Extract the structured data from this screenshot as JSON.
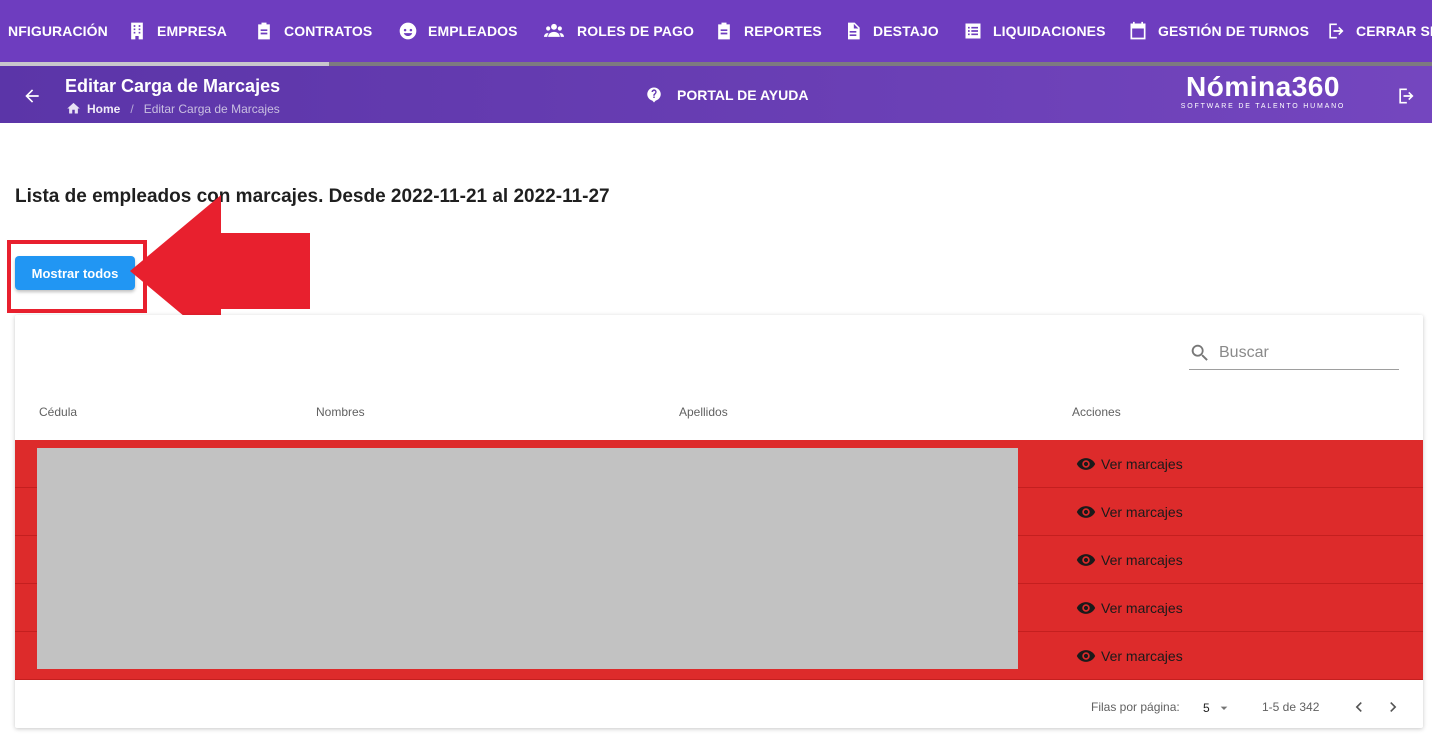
{
  "topnav": {
    "items": [
      {
        "label": "NFIGURACIÓN",
        "icon": "settings-icon"
      },
      {
        "label": "EMPRESA",
        "icon": "building-icon"
      },
      {
        "label": "CONTRATOS",
        "icon": "clipboard-icon"
      },
      {
        "label": "EMPLEADOS",
        "icon": "face-icon"
      },
      {
        "label": "ROLES DE PAGO",
        "icon": "group-icon"
      },
      {
        "label": "REPORTES",
        "icon": "clipboard-icon"
      },
      {
        "label": "DESTAJO",
        "icon": "document-icon"
      },
      {
        "label": "LIQUIDACIONES",
        "icon": "list-icon"
      },
      {
        "label": "GESTIÓN DE TURNOS",
        "icon": "calendar-icon"
      },
      {
        "label": "CERRAR SE",
        "icon": "logout-icon"
      }
    ],
    "scroll_progress": 0.23
  },
  "header": {
    "title": "Editar Carga de Marcajes",
    "breadcrumb": {
      "home": "Home",
      "current": "Editar Carga de Marcajes"
    },
    "help_label": "PORTAL DE AYUDA",
    "logo_main": "Nómina360",
    "logo_sub": "SOFTWARE DE TALENTO HUMANO"
  },
  "main": {
    "heading": "Lista de empleados con marcajes. Desde 2022-11-21 al 2022-11-27",
    "show_all_label": "Mostrar todos"
  },
  "table": {
    "search_placeholder": "Buscar",
    "columns": [
      "Cédula",
      "Nombres",
      "Apellidos",
      "Acciones"
    ],
    "rows": [
      {
        "action": "Ver marcajes"
      },
      {
        "action": "Ver marcajes"
      },
      {
        "action": "Ver marcajes"
      },
      {
        "action": "Ver marcajes"
      },
      {
        "action": "Ver marcajes"
      }
    ],
    "footer": {
      "rows_per_page_label": "Filas por página:",
      "rows_per_page_value": "5",
      "range": "1-5 de 342"
    }
  },
  "colors": {
    "nav_bg": "#6e3dbf",
    "row_highlight": "#dd2b2b",
    "primary_button": "#2196f3",
    "annotation_red": "#e8202e"
  }
}
